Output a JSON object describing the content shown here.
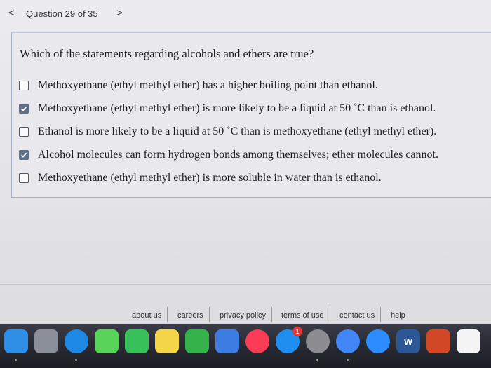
{
  "nav": {
    "prev_glyph": "<",
    "title": "Question 29 of 35",
    "next_glyph": ">"
  },
  "question": {
    "prompt": "Which of the statements regarding alcohols and ethers are true?",
    "options": [
      {
        "text": "Methoxyethane (ethyl methyl ether) has a higher boiling point than ethanol.",
        "checked": false
      },
      {
        "text": "Methoxyethane (ethyl methyl ether) is more likely to be a liquid at 50 ˚C than is ethanol.",
        "checked": true
      },
      {
        "text": "Ethanol is more likely to be a liquid at 50 ˚C than is methoxyethane (ethyl methyl ether).",
        "checked": false
      },
      {
        "text": "Alcohol molecules can form hydrogen bonds among themselves; ether molecules cannot.",
        "checked": true
      },
      {
        "text": "Methoxyethane (ethyl methyl ether) is more soluble in water than is ethanol.",
        "checked": false
      }
    ]
  },
  "footer": {
    "links": [
      "about us",
      "careers",
      "privacy policy",
      "terms of use",
      "contact us",
      "help"
    ]
  },
  "dock": {
    "icons": [
      {
        "name": "finder-icon",
        "color": "#2f8fe6"
      },
      {
        "name": "launchpad-icon",
        "color": "#8a8f99"
      },
      {
        "name": "safari-icon",
        "color": "#1e88e5"
      },
      {
        "name": "messages-icon",
        "color": "#5ad35a"
      },
      {
        "name": "facetime-icon",
        "color": "#38c05a"
      },
      {
        "name": "notes-icon",
        "color": "#f5d54a"
      },
      {
        "name": "numbers-icon",
        "color": "#35b24a"
      },
      {
        "name": "keynote-icon",
        "color": "#3d7ce0"
      },
      {
        "name": "music-icon",
        "color": "#fa3c57"
      },
      {
        "name": "app-store-icon",
        "color": "#1f8ef0"
      },
      {
        "name": "system-preferences-icon",
        "color": "#8c8c92"
      },
      {
        "name": "chrome-icon",
        "color": "#4285f4"
      },
      {
        "name": "zoom-icon",
        "color": "#2d8cff"
      },
      {
        "name": "word-icon",
        "color": "#2b5797"
      },
      {
        "name": "powerpoint-icon",
        "color": "#d24726"
      },
      {
        "name": "calendar-icon",
        "color": "#f4f4f4"
      }
    ],
    "word_letter": "W",
    "app_store_badge": "1"
  },
  "colors": {
    "checkbox_checked": "#5f6f86",
    "box_border": "#a9b2c6"
  }
}
